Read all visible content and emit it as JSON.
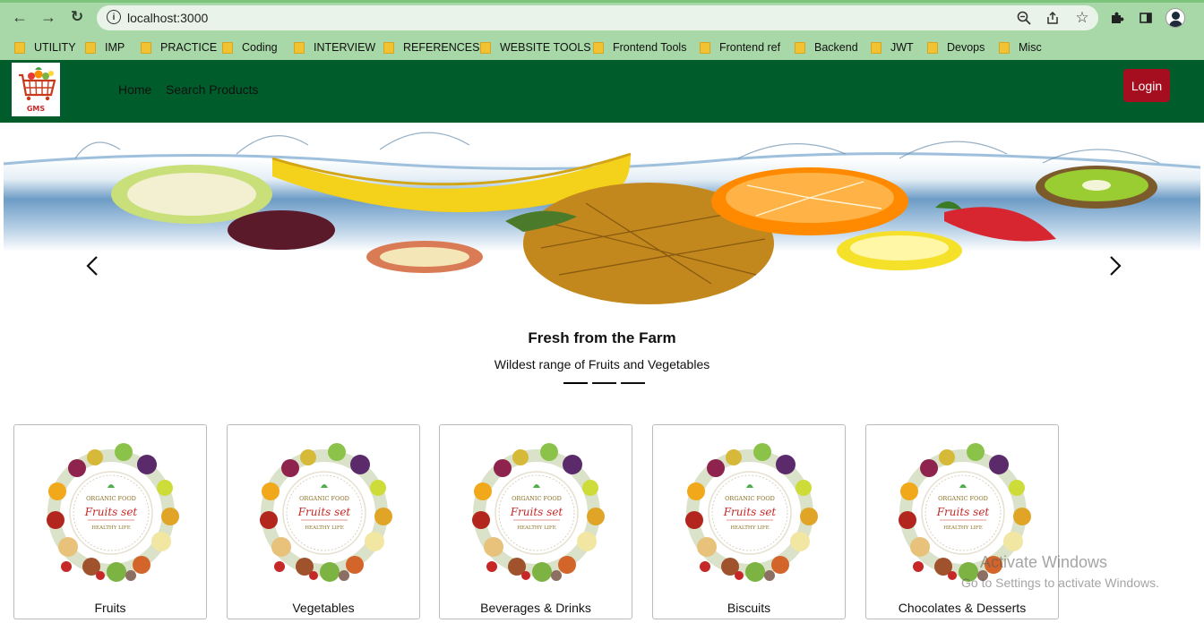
{
  "browser": {
    "url": "localhost:3000",
    "bookmarks": [
      "UTILITY",
      "IMP",
      "PRACTICE",
      "Coding",
      "INTERVIEW",
      "REFERENCES",
      "WEBSITE TOOLS",
      "Frontend Tools",
      "Frontend ref",
      "Backend",
      "JWT",
      "Devops",
      "Misc"
    ],
    "colors": {
      "chrome": "#a8d8a8",
      "omnibox": "#eaf3ea"
    }
  },
  "navbar": {
    "logo_text": "GMS",
    "links": [
      "Home",
      "Search Products"
    ],
    "login_label": "Login",
    "colors": {
      "background": "#005c2b",
      "login": "#a50e1f"
    }
  },
  "carousel": {
    "caption_title": "Fresh from the Farm",
    "caption_subtitle": "Wildest range of Fruits and Vegetables",
    "slide_count": 3,
    "active_index": 0
  },
  "categories": [
    {
      "label": "Fruits",
      "image_text": [
        "ORGANIC FOOD",
        "Fruits set",
        "HEALTHY LIFE"
      ]
    },
    {
      "label": "Vegetables",
      "image_text": [
        "ORGANIC FOOD",
        "Fruits set",
        "HEALTHY LIFE"
      ]
    },
    {
      "label": "Beverages & Drinks",
      "image_text": [
        "ORGANIC FOOD",
        "Fruits set",
        "HEALTHY LIFE"
      ]
    },
    {
      "label": "Biscuits",
      "image_text": [
        "ORGANIC FOOD",
        "Fruits set",
        "HEALTHY LIFE"
      ]
    },
    {
      "label": "Chocolates & Desserts",
      "image_text": [
        "ORGANIC FOOD",
        "Fruits set",
        "HEALTHY LIFE"
      ]
    }
  ],
  "watermark": {
    "line1": "Activate Windows",
    "line2": "Go to Settings to activate Windows."
  }
}
